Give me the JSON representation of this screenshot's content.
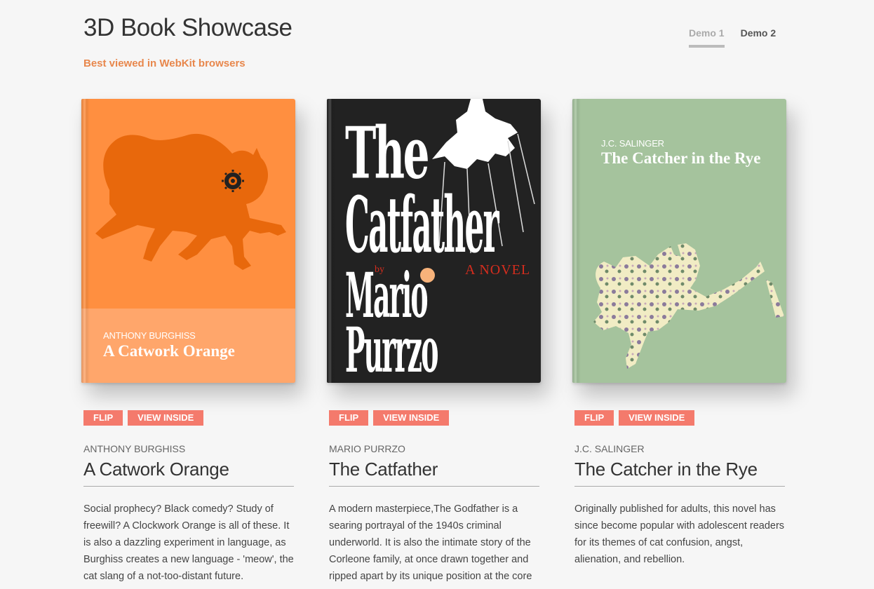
{
  "header": {
    "title": "3D Book Showcase",
    "subtitle": "Best viewed in WebKit browsers",
    "demos": [
      {
        "label": "Demo 1",
        "active": true
      },
      {
        "label": "Demo 2",
        "active": false
      }
    ]
  },
  "books": [
    {
      "cover_author": "ANTHONY BURGHISS",
      "cover_title": "A Catwork Orange",
      "flip_label": "FLIP",
      "inside_label": "VIEW INSIDE",
      "author": "ANTHONY BURGHISS",
      "title": "A Catwork Orange",
      "description": "Social prophecy? Black comedy? Study of freewill? A Clockwork Orange is all of these. It is also a dazzling experiment in language, as Burghiss creates a new language - 'meow', the cat slang of a not-too-distant future.",
      "cover_color": "#ff8f40"
    },
    {
      "cover_lines": [
        "The",
        "Catfather",
        "Mario",
        "Purrzo"
      ],
      "cover_by": "by",
      "cover_novel": "A NOVEL",
      "flip_label": "FLIP",
      "inside_label": "VIEW INSIDE",
      "author": "MARIO PURRZO",
      "title": "The Catfather",
      "description": "A modern masterpiece,The Godfather is a searing portrayal of the 1940s criminal underworld. It is also the intimate story of the Corleone family, at once drawn together and ripped apart by its unique position at the core",
      "cover_color": "#222222"
    },
    {
      "cover_author": "J.C. SALINGER",
      "cover_title": "The Catcher in the Rye",
      "flip_label": "FLIP",
      "inside_label": "VIEW INSIDE",
      "author": "J.C. SALINGER",
      "title": "The Catcher in the Rye",
      "description": "Originally published for adults, this novel has since become popular with adolescent readers for its themes of cat confusion, angst, alienation, and rebellion.",
      "cover_color": "#a5c39d"
    }
  ],
  "colors": {
    "accent": "#e8874c",
    "button": "#f47a6c"
  }
}
